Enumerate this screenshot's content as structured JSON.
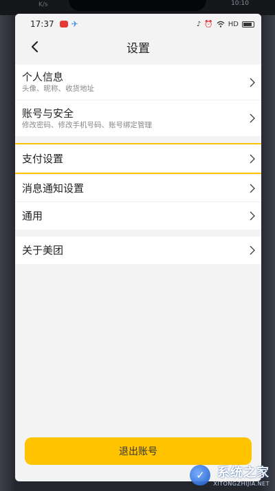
{
  "status_bar": {
    "time": "17:37",
    "right_text": "HD",
    "icons": [
      "notification-badge-icon",
      "alarm-icon",
      "wifi-icon",
      "battery-icon"
    ]
  },
  "bezel": {
    "left_text": "K/s",
    "right_text": "10:10"
  },
  "header": {
    "title": "设置",
    "back_icon": "chevron-left-icon"
  },
  "groups": [
    {
      "items": [
        {
          "title": "个人信息",
          "subtitle": "头像、昵称、收货地址"
        },
        {
          "title": "账号与安全",
          "subtitle": "修改密码、修改手机号码、账号绑定管理"
        }
      ]
    },
    {
      "items": [
        {
          "title": "支付设置",
          "highlighted": true
        },
        {
          "title": "消息通知设置"
        },
        {
          "title": "通用"
        }
      ]
    },
    {
      "items": [
        {
          "title": "关于美团"
        }
      ]
    }
  ],
  "logout_label": "退出账号",
  "watermark": {
    "title": "系统之家",
    "subtitle": "XITONGZHIJIA.NET"
  },
  "colors": {
    "accent": "#ffc300",
    "background": "#f3f3f3"
  }
}
